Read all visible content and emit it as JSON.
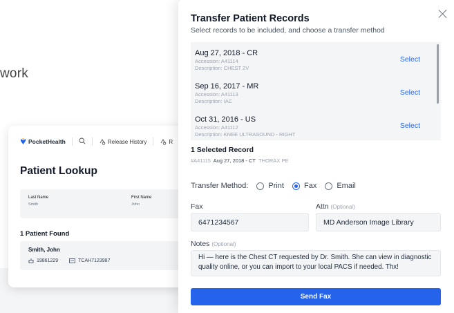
{
  "background": {
    "partial_text": "work"
  },
  "app": {
    "brand": "PocketHealth",
    "nav": {
      "release_history": "Release History",
      "truncated_item": "R"
    },
    "page_title": "Patient Lookup",
    "search": {
      "last_name_label": "Last Name",
      "last_name_value": "Smith",
      "first_name_label": "First Name",
      "first_name_value": "John"
    },
    "results_count": "1 Patient Found",
    "patient": {
      "name": "Smith, John",
      "dob": "19861229",
      "mrn": "TCAH7123987"
    }
  },
  "modal": {
    "title": "Transfer Patient Records",
    "subtitle": "Select records to be included, and choose a transfer method",
    "records": [
      {
        "title": "Aug 27, 2018 - CR",
        "accession": "Accession: A41114",
        "description": "Description: CHEST 2V",
        "action": "Select"
      },
      {
        "title": "Sep 16, 2017 - MR",
        "accession": "Accession: A41113",
        "description": "Description: IAC",
        "action": "Select"
      },
      {
        "title": "Oct 31, 2016 - US",
        "accession": "Accession: A41112",
        "description": "Description: KNEE ULTRASOUND - RIGHT",
        "action": "Select"
      }
    ],
    "selected": {
      "heading": "1 Selected Record",
      "id": "#A41115",
      "date_modality": "Aug 27, 2018 - CT",
      "description": "THORAX PE"
    },
    "transfer_method": {
      "label": "Transfer Method:",
      "options": [
        "Print",
        "Fax",
        "Email"
      ],
      "selected": "Fax"
    },
    "fax": {
      "label": "Fax",
      "value": "6471234567"
    },
    "attn": {
      "label": "Attn",
      "optional": "(Optional)",
      "value": "MD Anderson Image Library"
    },
    "notes": {
      "label": "Notes",
      "optional": "(Optional)",
      "value": "Hi — here is the Chest CT requested by Dr. Smith. She can view in diagnostic quality online, or you can import to your local PACS if needed. Thx!"
    },
    "send_button": "Send Fax"
  },
  "colors": {
    "accent": "#2563eb",
    "muted": "#9ca3af",
    "field_bg": "#f4f5f7"
  }
}
